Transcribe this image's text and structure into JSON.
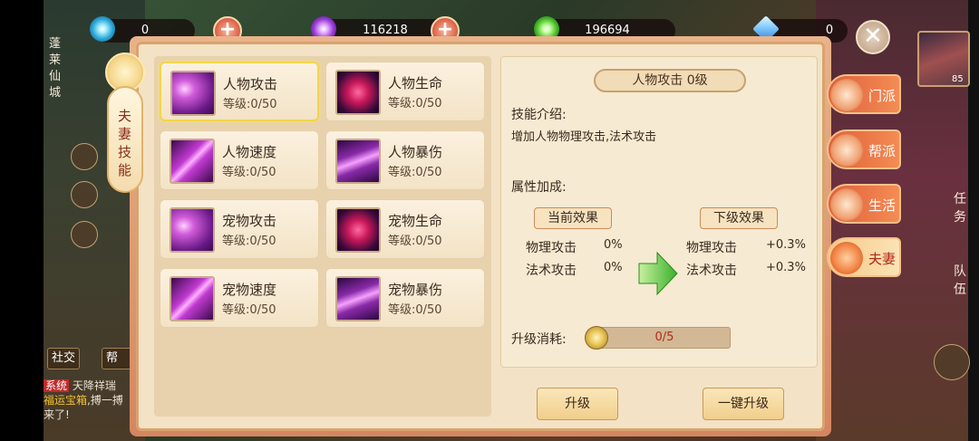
{
  "currency": [
    {
      "icon": "blue-jade-icon",
      "value": "0"
    },
    {
      "icon": "purple-jade-icon",
      "value": "116218"
    },
    {
      "icon": "green-jade-icon",
      "value": "196694"
    },
    {
      "icon": "diamond-icon",
      "value": "0"
    }
  ],
  "ribbon": {
    "label_chars": [
      "夫",
      "妻",
      "技",
      "能"
    ]
  },
  "left_scene_text": {
    "place": "蓬莱仙城",
    "social": "社交",
    "guild": "帮"
  },
  "skills": [
    {
      "name": "人物攻击",
      "level": "等级:0/50",
      "type": "atk"
    },
    {
      "name": "人物生命",
      "level": "等级:0/50",
      "type": "life"
    },
    {
      "name": "人物速度",
      "level": "等级:0/50",
      "type": "speed"
    },
    {
      "name": "人物暴伤",
      "level": "等级:0/50",
      "type": "crit"
    },
    {
      "name": "宠物攻击",
      "level": "等级:0/50",
      "type": "atk"
    },
    {
      "name": "宠物生命",
      "level": "等级:0/50",
      "type": "life"
    },
    {
      "name": "宠物速度",
      "level": "等级:0/50",
      "type": "speed"
    },
    {
      "name": "宠物暴伤",
      "level": "等级:0/50",
      "type": "crit"
    }
  ],
  "detail": {
    "title": "人物攻击 0级",
    "intro_label": "技能介绍:",
    "intro_text": "增加人物物理攻击,法术攻击",
    "attr_label": "属性加成:",
    "current_label": "当前效果",
    "next_label": "下级效果",
    "current": [
      {
        "name": "物理攻击",
        "value": "0%"
      },
      {
        "name": "法术攻击",
        "value": "0%"
      }
    ],
    "next": [
      {
        "name": "物理攻击",
        "value": "+0.3%"
      },
      {
        "name": "法术攻击",
        "value": "+0.3%"
      }
    ],
    "cost_label": "升级消耗:",
    "cost_value": "0/5"
  },
  "buttons": {
    "upgrade": "升级",
    "one_click": "一键升级"
  },
  "tabs": [
    {
      "label": "门派",
      "active": false
    },
    {
      "label": "帮派",
      "active": false
    },
    {
      "label": "生活",
      "active": false
    },
    {
      "label": "夫妻",
      "active": true
    }
  ],
  "right_side": {
    "task_chars": [
      "任",
      "务"
    ],
    "team_chars": [
      "队",
      "伍"
    ],
    "avatar_level": "85"
  },
  "chat": {
    "tag": "系统",
    "line1": "天降祥瑞",
    "line2_gold": "福运宝箱",
    "line2": ",搏一搏",
    "line3": "来了!"
  },
  "colors": {
    "accent": "#e0603a",
    "panel_bg": "#f3e2c5",
    "cost_text": "#b22a1a"
  }
}
